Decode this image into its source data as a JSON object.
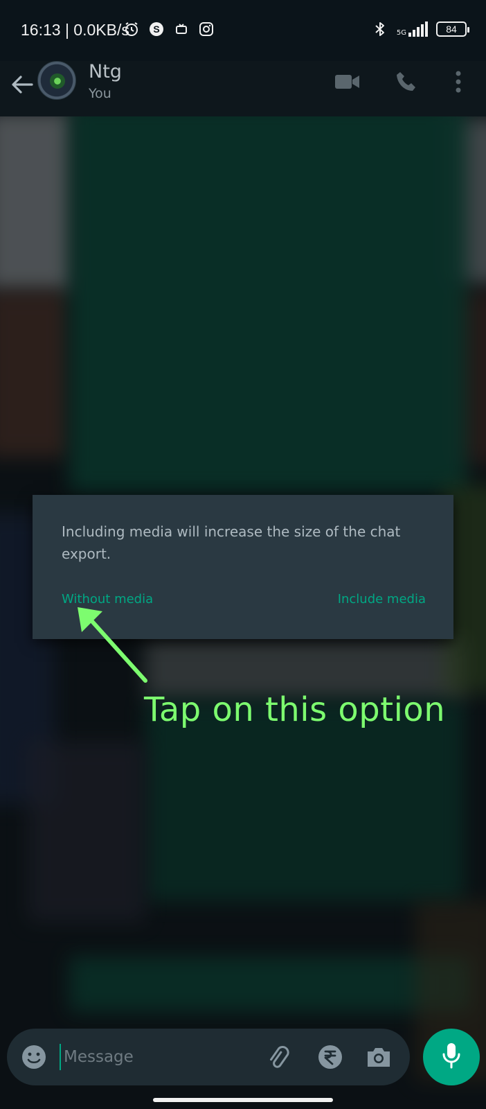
{
  "status_bar": {
    "time": "16:13 | 0.0KB/s",
    "network_label": "5G",
    "battery": "84",
    "icons": [
      "alarm-icon",
      "s-app-icon",
      "notification-icon",
      "instagram-icon",
      "bluetooth-icon",
      "signal-icon",
      "battery-icon"
    ]
  },
  "header": {
    "contact_name": "Ntg",
    "subtitle": "You",
    "icons": [
      "back-arrow-icon",
      "video-call-icon",
      "voice-call-icon",
      "more-options-icon"
    ]
  },
  "dialog": {
    "message": "Including media will increase the size of the chat export.",
    "without_media_label": "Without media",
    "include_media_label": "Include media",
    "accent_color": "#00a884"
  },
  "annotation": {
    "text": "Tap on this option",
    "color": "#7dfc6f"
  },
  "input_bar": {
    "placeholder": "Message",
    "icons": [
      "emoji-icon",
      "attach-icon",
      "rupee-payment-icon",
      "camera-icon",
      "mic-icon"
    ]
  },
  "colors": {
    "background": "#0b141a",
    "dialog_background": "#2a3942",
    "accent": "#00a884"
  }
}
